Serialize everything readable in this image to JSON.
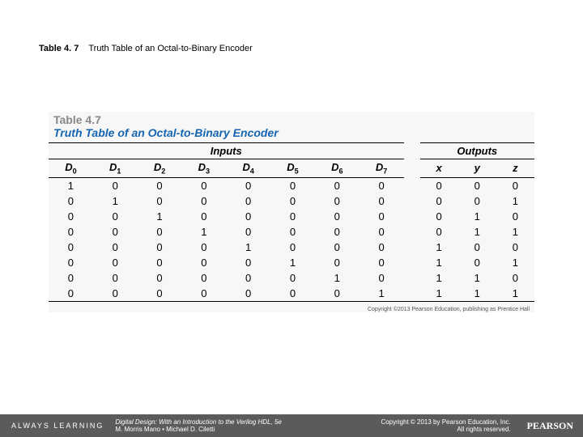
{
  "header": {
    "table_label": "Table 4. 7",
    "caption": "Truth Table of an Octal-to-Binary Encoder"
  },
  "table": {
    "title_num": "Table 4.7",
    "title_text": "Truth Table of an Octal-to-Binary Encoder",
    "section_inputs": "Inputs",
    "section_outputs": "Outputs",
    "input_headers": [
      "D",
      "D",
      "D",
      "D",
      "D",
      "D",
      "D",
      "D"
    ],
    "input_subs": [
      "0",
      "1",
      "2",
      "3",
      "4",
      "5",
      "6",
      "7"
    ],
    "output_headers": [
      "x",
      "y",
      "z"
    ],
    "rows": [
      {
        "in": [
          "1",
          "0",
          "0",
          "0",
          "0",
          "0",
          "0",
          "0"
        ],
        "out": [
          "0",
          "0",
          "0"
        ]
      },
      {
        "in": [
          "0",
          "1",
          "0",
          "0",
          "0",
          "0",
          "0",
          "0"
        ],
        "out": [
          "0",
          "0",
          "1"
        ]
      },
      {
        "in": [
          "0",
          "0",
          "1",
          "0",
          "0",
          "0",
          "0",
          "0"
        ],
        "out": [
          "0",
          "1",
          "0"
        ]
      },
      {
        "in": [
          "0",
          "0",
          "0",
          "1",
          "0",
          "0",
          "0",
          "0"
        ],
        "out": [
          "0",
          "1",
          "1"
        ]
      },
      {
        "in": [
          "0",
          "0",
          "0",
          "0",
          "1",
          "0",
          "0",
          "0"
        ],
        "out": [
          "1",
          "0",
          "0"
        ]
      },
      {
        "in": [
          "0",
          "0",
          "0",
          "0",
          "0",
          "1",
          "0",
          "0"
        ],
        "out": [
          "1",
          "0",
          "1"
        ]
      },
      {
        "in": [
          "0",
          "0",
          "0",
          "0",
          "0",
          "0",
          "1",
          "0"
        ],
        "out": [
          "1",
          "1",
          "0"
        ]
      },
      {
        "in": [
          "0",
          "0",
          "0",
          "0",
          "0",
          "0",
          "0",
          "1"
        ],
        "out": [
          "1",
          "1",
          "1"
        ]
      }
    ],
    "copyright": "Copyright ©2013 Pearson Education, publishing as Prentice Hall"
  },
  "footer": {
    "always": "ALWAYS LEARNING",
    "book_title": "Digital Design: With an Introduction to the Verilog HDL",
    "book_edition": ", 5e",
    "authors": "M. Morris Mano • Michael D. Ciletti",
    "copyright": "Copyright © 2013 by Pearson Education, Inc.",
    "rights": "All rights reserved.",
    "logo": "PEARSON"
  },
  "chart_data": {
    "type": "table",
    "title": "Truth Table of an Octal-to-Binary Encoder",
    "columns": [
      "D0",
      "D1",
      "D2",
      "D3",
      "D4",
      "D5",
      "D6",
      "D7",
      "x",
      "y",
      "z"
    ],
    "rows": [
      [
        1,
        0,
        0,
        0,
        0,
        0,
        0,
        0,
        0,
        0,
        0
      ],
      [
        0,
        1,
        0,
        0,
        0,
        0,
        0,
        0,
        0,
        0,
        1
      ],
      [
        0,
        0,
        1,
        0,
        0,
        0,
        0,
        0,
        0,
        1,
        0
      ],
      [
        0,
        0,
        0,
        1,
        0,
        0,
        0,
        0,
        0,
        1,
        1
      ],
      [
        0,
        0,
        0,
        0,
        1,
        0,
        0,
        0,
        1,
        0,
        0
      ],
      [
        0,
        0,
        0,
        0,
        0,
        1,
        0,
        0,
        1,
        0,
        1
      ],
      [
        0,
        0,
        0,
        0,
        0,
        0,
        1,
        0,
        1,
        1,
        0
      ],
      [
        0,
        0,
        0,
        0,
        0,
        0,
        0,
        1,
        1,
        1,
        1
      ]
    ]
  }
}
